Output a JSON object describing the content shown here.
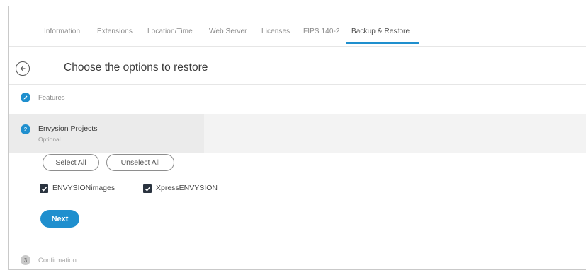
{
  "tabs": [
    {
      "label": "Information",
      "active": false
    },
    {
      "label": "Extensions",
      "active": false
    },
    {
      "label": "Location/Time",
      "active": false
    },
    {
      "label": "Web Server",
      "active": false
    },
    {
      "label": "Licenses",
      "active": false
    },
    {
      "label": "FIPS 140-2",
      "active": false
    },
    {
      "label": "Backup & Restore",
      "active": true
    }
  ],
  "header": {
    "back_icon": "arrow-left-icon",
    "title": "Choose the options to restore"
  },
  "steps": [
    {
      "label": "Features",
      "status": "completed",
      "icon": "pencil-icon"
    },
    {
      "label": "Envysion Projects",
      "sublabel": "Optional",
      "status": "active",
      "number": "2"
    },
    {
      "label": "Confirmation",
      "status": "pending",
      "number": "3"
    }
  ],
  "selection": {
    "select_all": "Select All",
    "unselect_all": "Unselect All"
  },
  "options": [
    {
      "label": "ENVYSIONimages",
      "checked": true
    },
    {
      "label": "XpressENVYSION",
      "checked": true
    }
  ],
  "next_label": "Next",
  "colors": {
    "accent": "#1f8fce",
    "checkbox": "#2b3440"
  }
}
